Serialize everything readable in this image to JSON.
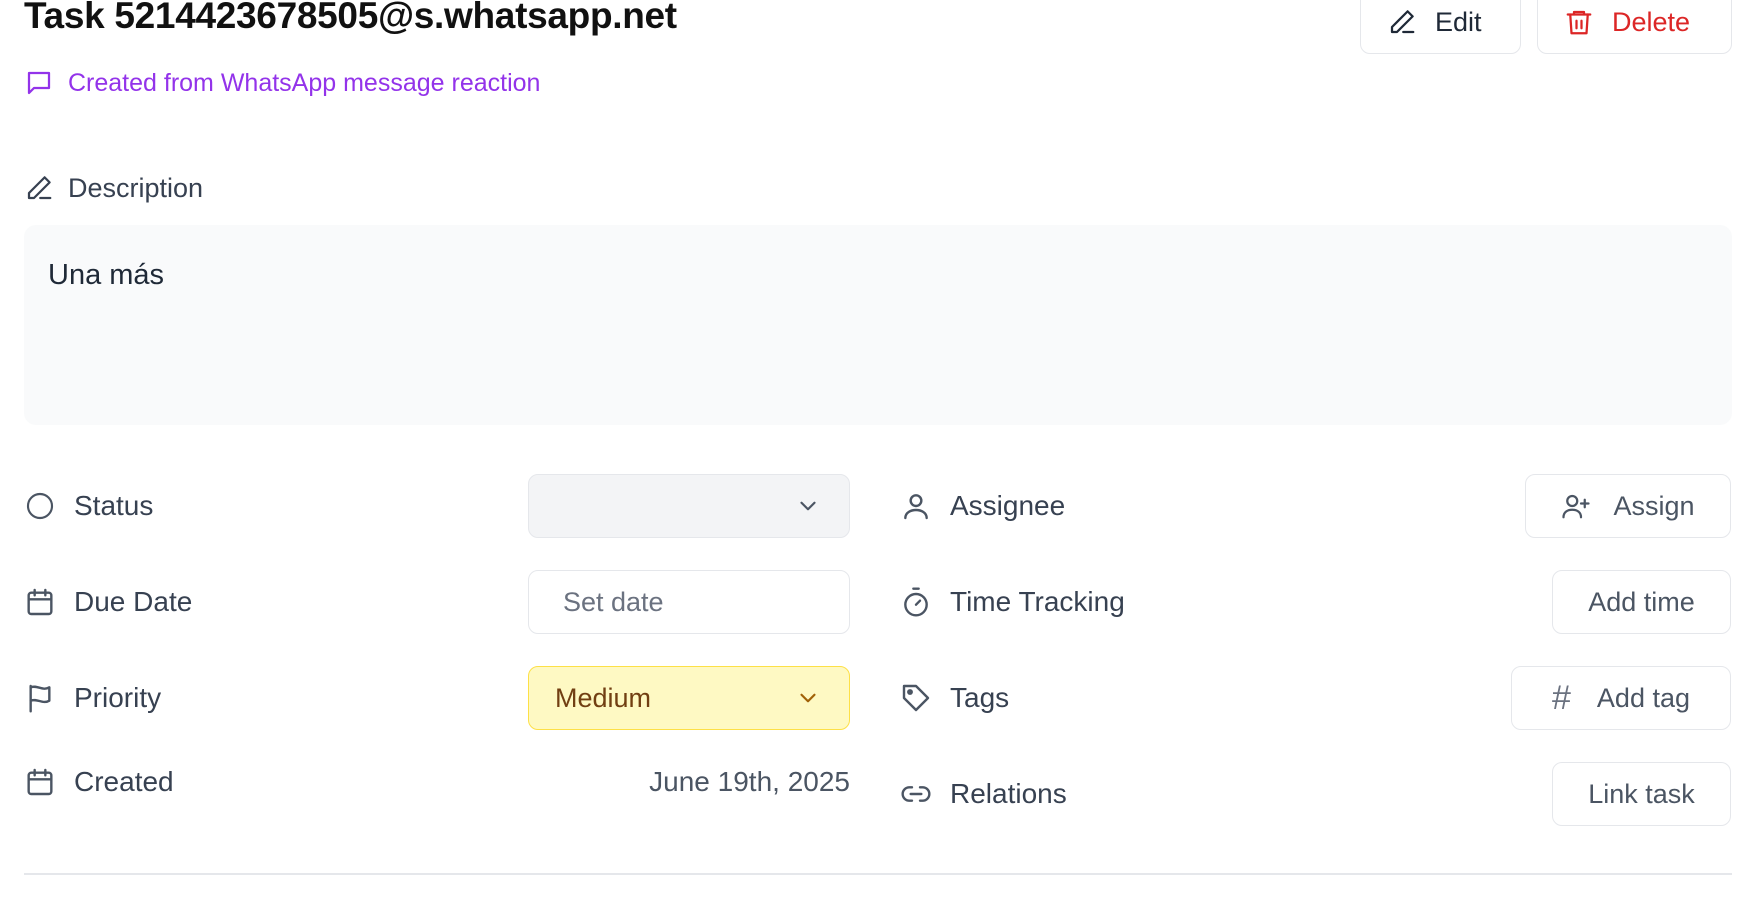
{
  "header": {
    "title": "Task 5214423678505@s.whatsapp.net",
    "source_note": "Created from WhatsApp message reaction",
    "edit_label": "Edit",
    "delete_label": "Delete"
  },
  "description": {
    "label": "Description",
    "text": "Una más"
  },
  "properties": {
    "status": {
      "label": "Status",
      "value": ""
    },
    "due_date": {
      "label": "Due Date",
      "placeholder": "Set date"
    },
    "priority": {
      "label": "Priority",
      "value": "Medium"
    },
    "created": {
      "label": "Created",
      "value": "June 19th, 2025"
    },
    "assignee": {
      "label": "Assignee",
      "button": "Assign"
    },
    "time_tracking": {
      "label": "Time Tracking",
      "button": "Add time"
    },
    "tags": {
      "label": "Tags",
      "button": "Add tag"
    },
    "relations": {
      "label": "Relations",
      "button": "Link task"
    }
  },
  "icons": {
    "source_note": "message-square-icon",
    "edit": "pencil-icon",
    "delete": "trash-icon",
    "description": "pencil-icon",
    "status": "circle-icon",
    "due_date": "calendar-icon",
    "priority": "flag-icon",
    "created": "calendar-icon",
    "assignee": "user-icon",
    "assign": "user-plus-icon",
    "time_tracking": "timer-icon",
    "tags": "tag-icon",
    "add_tag": "hash-icon",
    "relations": "link-icon",
    "dropdown": "chevron-down-icon"
  },
  "colors": {
    "accent_purple": "#9333ea",
    "danger_red": "#dc2626",
    "priority_medium_bg": "#fef9c3",
    "priority_medium_text": "#713f12"
  }
}
